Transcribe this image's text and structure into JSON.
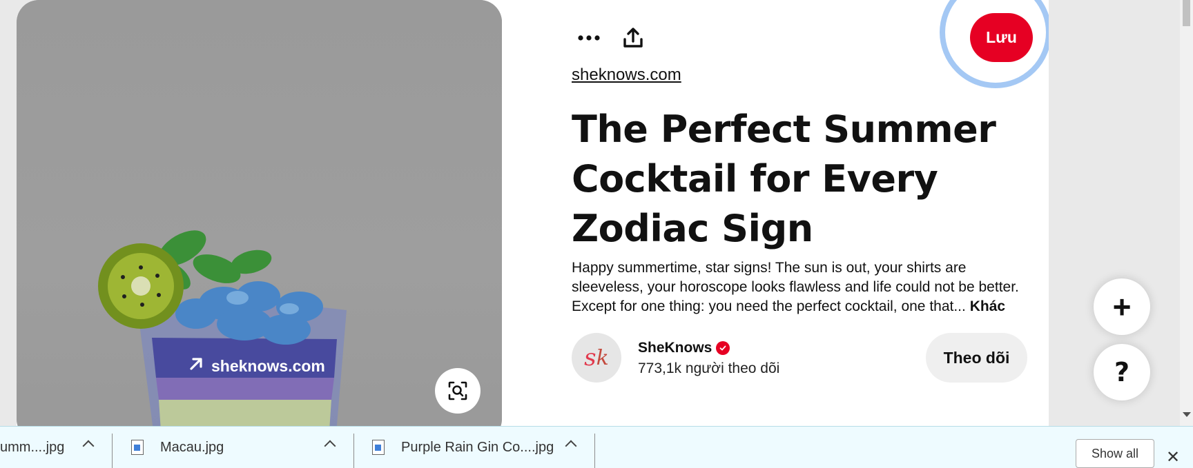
{
  "pin": {
    "source_link": "sheknows.com",
    "actions": {
      "more_icon": "ellipsis-icon",
      "share_icon": "share-icon",
      "save_label": "Lưu"
    },
    "domain": "sheknows.com",
    "title": "The Perfect Summer Cocktail for Every Zodiac Sign",
    "description": "Happy summertime, star signs! The sun is out, your shirts are sleeveless, your horoscope looks flawless and life could not be better. Except for one thing: you need the perfect cocktail, one that... ",
    "more_label": "Khác",
    "creator": {
      "name": "SheKnows",
      "avatar_initial_1": "s",
      "avatar_initial_2": "k",
      "followers": "773,1k người theo dõi",
      "follow_label": "Theo dõi"
    }
  },
  "fab": {
    "add": "+",
    "help": "?"
  },
  "downloads": {
    "items": [
      {
        "name": "umm....jpg"
      },
      {
        "name": "Macau.jpg"
      },
      {
        "name": "Purple Rain Gin Co....jpg"
      }
    ],
    "show_all": "Show all",
    "close": "✕"
  },
  "colors": {
    "save": "#e60023",
    "focus_ring": "#a4c8f4",
    "download_bar": "#eefbff"
  }
}
